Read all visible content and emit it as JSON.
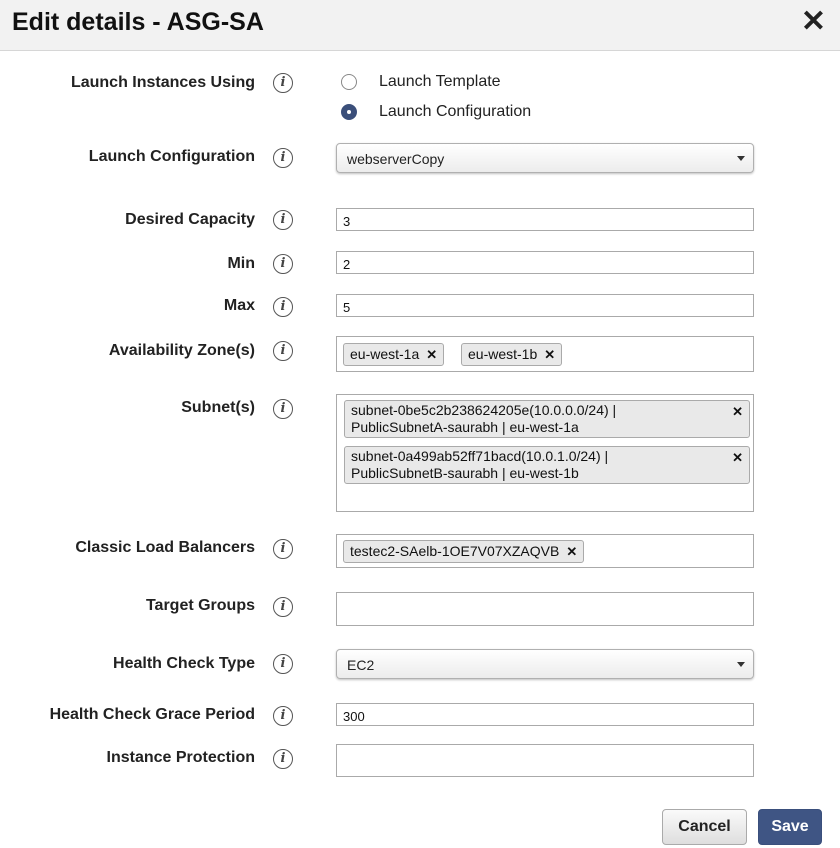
{
  "dialog": {
    "title": "Edit details - ASG-SA",
    "close_glyph": "✕"
  },
  "fields": {
    "launch_using": {
      "label": "Launch Instances Using",
      "options": [
        "Launch Template",
        "Launch Configuration"
      ],
      "selected": "Launch Configuration"
    },
    "launch_configuration": {
      "label": "Launch Configuration",
      "value": "webserverCopy"
    },
    "desired_capacity": {
      "label": "Desired Capacity",
      "value": "3"
    },
    "min": {
      "label": "Min",
      "value": "2"
    },
    "max": {
      "label": "Max",
      "value": "5"
    },
    "availability_zones": {
      "label": "Availability Zone(s)",
      "tags": [
        "eu-west-1a",
        "eu-west-1b"
      ]
    },
    "subnets": {
      "label": "Subnet(s)",
      "tags": [
        {
          "line1": "subnet-0be5c2b238624205e(10.0.0.0/24) |",
          "line2": "PublicSubnetA-saurabh | eu-west-1a"
        },
        {
          "line1": "subnet-0a499ab52ff71bacd(10.0.1.0/24) |",
          "line2": "PublicSubnetB-saurabh | eu-west-1b"
        }
      ]
    },
    "classic_load_balancers": {
      "label": "Classic Load Balancers",
      "tags": [
        "testec2-SAelb-1OE7V07XZAQVB"
      ]
    },
    "target_groups": {
      "label": "Target Groups",
      "value": ""
    },
    "health_check_type": {
      "label": "Health Check Type",
      "value": "EC2"
    },
    "health_check_grace_period": {
      "label": "Health Check Grace Period",
      "value": "300"
    },
    "instance_protection": {
      "label": "Instance Protection",
      "value": ""
    }
  },
  "info_glyph": "i",
  "remove_glyph": "✕",
  "buttons": {
    "cancel": "Cancel",
    "save": "Save"
  },
  "colors": {
    "accent": "#3f5584",
    "header_bg": "#f2f2f2"
  }
}
